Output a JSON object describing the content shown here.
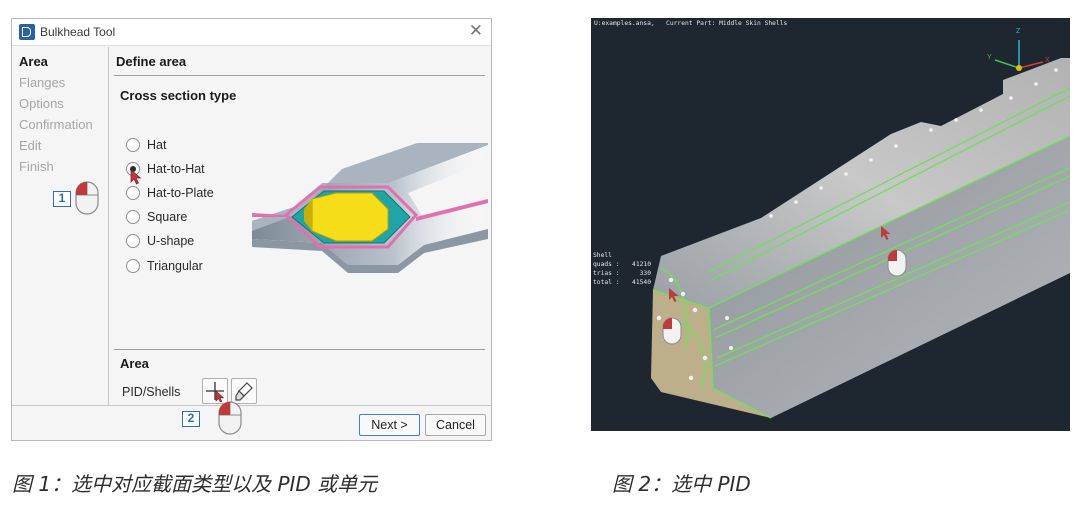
{
  "figure1": {
    "window_title": "Bulkhead Tool",
    "nav": [
      "Area",
      "Flanges",
      "Options",
      "Confirmation",
      "Edit",
      "Finish"
    ],
    "active_nav": "Area",
    "define_area_heading": "Define area",
    "cross_section_heading": "Cross section type",
    "section_types": [
      {
        "label": "Hat",
        "checked": false
      },
      {
        "label": "Hat-to-Hat",
        "checked": true
      },
      {
        "label": "Hat-to-Plate",
        "checked": false
      },
      {
        "label": "Square",
        "checked": false
      },
      {
        "label": "U-shape",
        "checked": false
      },
      {
        "label": "Triangular",
        "checked": false
      }
    ],
    "area_heading": "Area",
    "pid_label": "PID/Shells",
    "next_label": "Next >",
    "cancel_label": "Cancel",
    "step1": "1",
    "step2": "2",
    "icons": {
      "close": "close-icon",
      "cross_pick": "crosshair-icon",
      "pick_tool": "brush-icon",
      "mouse": "mouse-left-click-icon"
    },
    "colors": {
      "accent": "#2670c2",
      "section_fill": "#f5dd1a",
      "section_teal": "#1fa5a5",
      "section_pink": "#e46fb0"
    }
  },
  "figure2": {
    "header": "U:examples.ansa,   Current Part: Middle Skin Shells",
    "stats_title": "Shell",
    "stats": [
      {
        "label": "quads :",
        "value": "41210"
      },
      {
        "label": "trias :",
        "value": "330"
      },
      {
        "label": "total :",
        "value": "41540"
      }
    ],
    "axes": {
      "x": "X",
      "y": "Y",
      "z": "Z"
    },
    "colors": {
      "background": "#1e2630",
      "edge": "#6ee05a",
      "surface": "#c9c9c9"
    }
  },
  "captions": {
    "fig1": "图 1：选中对应截面类型以及 PID 或单元",
    "fig2": "图 2：选中 PID"
  }
}
